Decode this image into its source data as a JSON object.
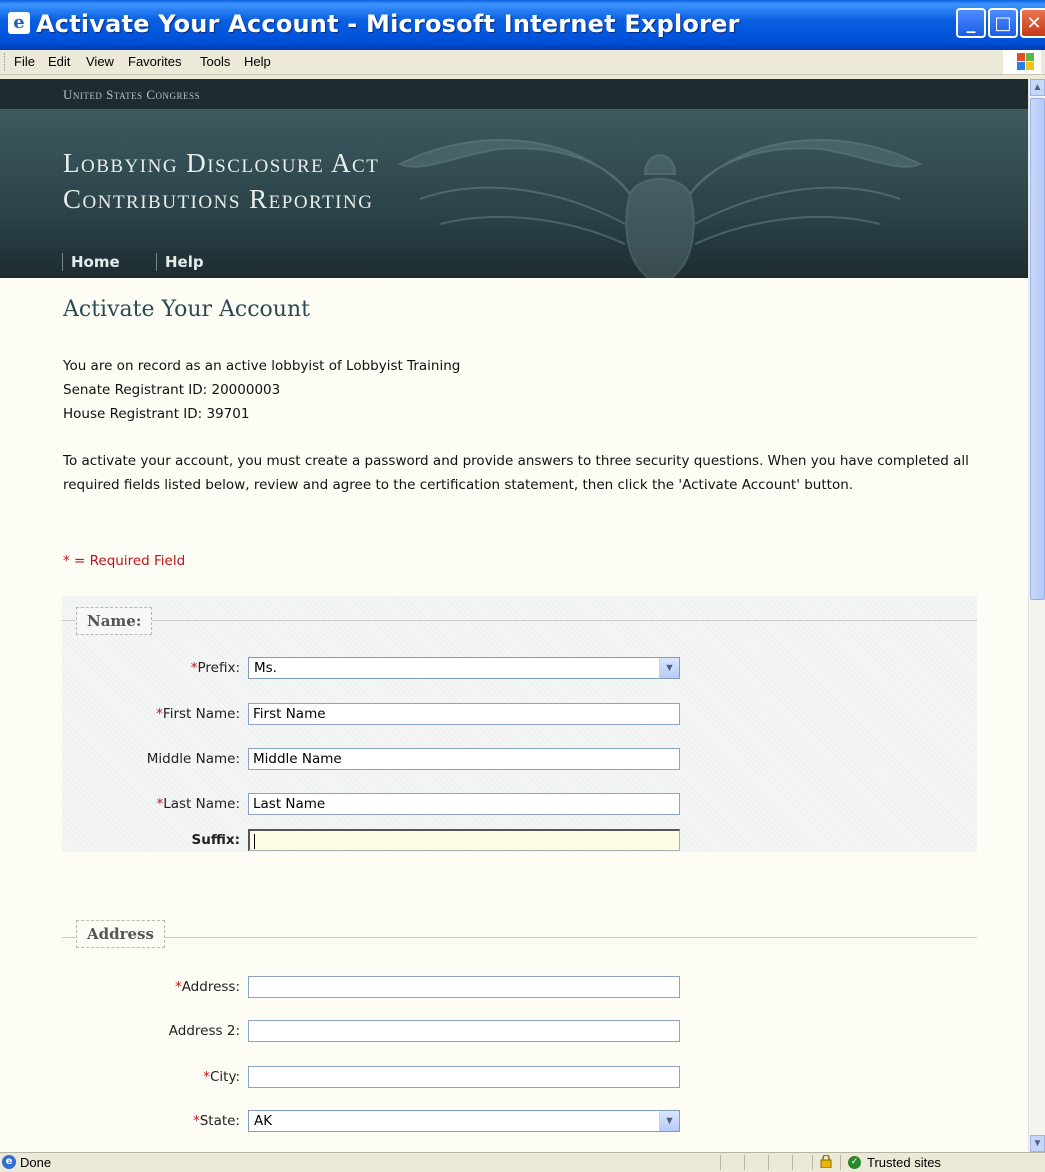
{
  "window": {
    "title": "Activate Your Account - Microsoft Internet Explorer",
    "minimize_icon": "minimize-icon",
    "maximize_icon": "maximize-icon",
    "close_icon": "close-icon"
  },
  "menu": [
    "File",
    "Edit",
    "View",
    "Favorites",
    "Tools",
    "Help"
  ],
  "banner": {
    "congress": "United States Congress",
    "heading_line1": "Lobbying Disclosure Act",
    "heading_line2": "Contributions Reporting",
    "nav": [
      "Home",
      "Help"
    ]
  },
  "page": {
    "title": "Activate Your Account",
    "intro_line1": "You are on record as an active lobbyist of Lobbyist Training",
    "intro_line2": "Senate Registrant ID: 20000003",
    "intro_line3": "House Registrant ID: 39701",
    "instructions": "To activate your account, you must create a password and provide answers to three security questions. When you have completed all required fields listed below, review and agree to the certification statement, then click the 'Activate Account' button.",
    "required_note": "* = Required Field"
  },
  "name_section": {
    "legend": "Name:",
    "prefix": {
      "label": "Prefix:",
      "value": "Ms."
    },
    "first_name": {
      "label": "First Name:",
      "value": "First Name"
    },
    "middle_name": {
      "label": "Middle Name:",
      "value": "Middle Name"
    },
    "last_name": {
      "label": "Last Name:",
      "value": "Last Name"
    },
    "suffix": {
      "label": "Suffix:",
      "value": ""
    }
  },
  "address_section": {
    "legend": "Address",
    "address": {
      "label": "Address:",
      "value": ""
    },
    "address2": {
      "label": "Address 2:",
      "value": ""
    },
    "city": {
      "label": "City:",
      "value": ""
    },
    "state": {
      "label": "State:",
      "value": "AK"
    }
  },
  "required_marker": "*",
  "status": {
    "text": "Done",
    "zone": "Trusted sites"
  },
  "colors": {
    "banner": "#2a4349",
    "required": "#c0141b",
    "title_bar": "#0a5fe0"
  }
}
